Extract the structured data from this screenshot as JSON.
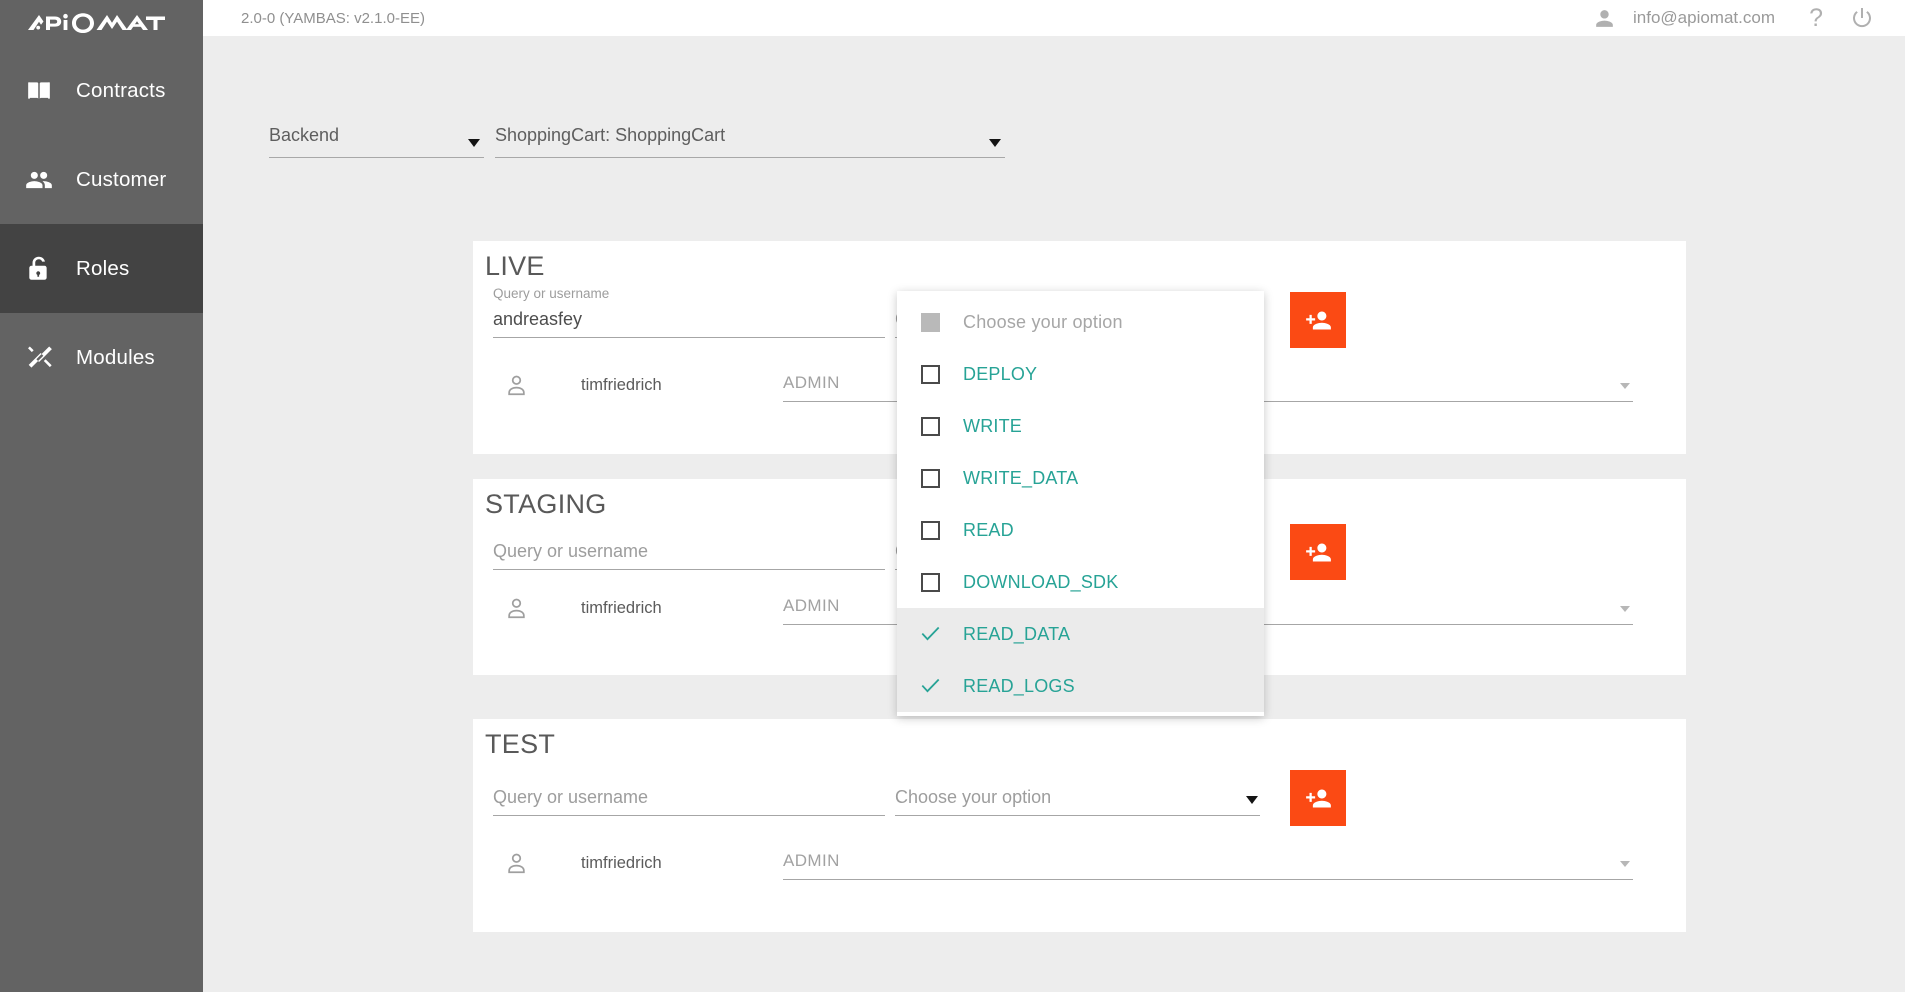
{
  "brand": {
    "logo_text": "APiOMAT",
    "accent_orange": "#fb4a14",
    "accent_teal": "#27a396",
    "sidebar_bg": "#636363",
    "sidebar_active_bg": "#434343",
    "page_bg": "#ededed"
  },
  "sidebar": {
    "items": [
      {
        "label": "Contracts",
        "icon": "book-icon",
        "active": false
      },
      {
        "label": "Customer",
        "icon": "people-icon",
        "active": false
      },
      {
        "label": "Roles",
        "icon": "lock-icon",
        "active": true
      },
      {
        "label": "Modules",
        "icon": "tools-icon",
        "active": false
      }
    ]
  },
  "topbar": {
    "version": "2.0-0 (YAMBAS: v2.1.0-EE)",
    "user_email": "info@apiomat.com",
    "account_icon": "person-icon",
    "help_icon": "question-mark-icon",
    "power_icon": "power-icon"
  },
  "selectors": {
    "backend": {
      "label": "Backend",
      "caret": "caret-down-icon"
    },
    "module": {
      "label": "ShoppingCart: ShoppingCart",
      "caret": "caret-down-icon"
    }
  },
  "cards": [
    {
      "title": "LIVE",
      "query": {
        "caption": "Query or username",
        "value": "andreasfey",
        "placeholder": "Query or username"
      },
      "option": {
        "value": "",
        "placeholder": "Choose your option"
      },
      "add_button": "add-person-icon",
      "users": [
        {
          "name": "timfriedrich",
          "role": "ADMIN"
        }
      ]
    },
    {
      "title": "STAGING",
      "query": {
        "caption": "",
        "value": "",
        "placeholder": "Query or username"
      },
      "option": {
        "value": "",
        "placeholder": "Choose your option"
      },
      "add_button": "add-person-icon",
      "users": [
        {
          "name": "timfriedrich",
          "role": "ADMIN"
        }
      ]
    },
    {
      "title": "TEST",
      "query": {
        "caption": "",
        "value": "",
        "placeholder": "Query or username"
      },
      "option": {
        "value": "",
        "placeholder": "Choose your option"
      },
      "add_button": "add-person-icon",
      "users": [
        {
          "name": "timfriedrich",
          "role": "ADMIN"
        }
      ]
    }
  ],
  "dropdown": {
    "open": true,
    "header": {
      "label": "Choose your option",
      "state": "indeterminate"
    },
    "options": [
      {
        "label": "DEPLOY",
        "checked": false
      },
      {
        "label": "WRITE",
        "checked": false
      },
      {
        "label": "WRITE_DATA",
        "checked": false
      },
      {
        "label": "READ",
        "checked": false
      },
      {
        "label": "DOWNLOAD_SDK",
        "checked": false
      },
      {
        "label": "READ_DATA",
        "checked": true
      },
      {
        "label": "READ_LOGS",
        "checked": true
      }
    ]
  }
}
